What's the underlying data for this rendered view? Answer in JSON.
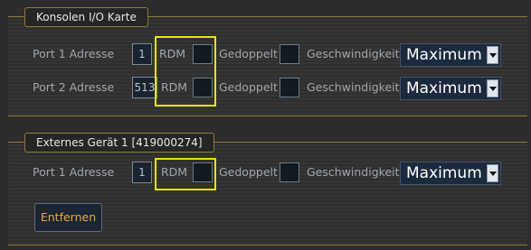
{
  "console_card": {
    "title": "Konsolen I/O Karte",
    "ports": [
      {
        "label": "Port 1 Adresse",
        "address": "1",
        "rdm_label": "RDM",
        "duplicate_label": "Gedoppelt",
        "speed_label": "Geschwindigkeit",
        "speed_value": "Maximum"
      },
      {
        "label": "Port 2 Adresse",
        "address": "513",
        "rdm_label": "RDM",
        "duplicate_label": "Gedoppelt",
        "speed_label": "Geschwindigkeit",
        "speed_value": "Maximum"
      }
    ]
  },
  "external_device": {
    "title": "Externes Gerät 1  [419000274]",
    "ports": [
      {
        "label": "Port 1 Adresse",
        "address": "1",
        "rdm_label": "RDM",
        "duplicate_label": "Gedoppelt",
        "speed_label": "Geschwindigkeit",
        "speed_value": "Maximum"
      }
    ],
    "remove_button": "Entfernen"
  },
  "colors": {
    "highlight": "#e6e600",
    "panel_border": "#8a7a3e",
    "button_text": "#e8a740"
  }
}
